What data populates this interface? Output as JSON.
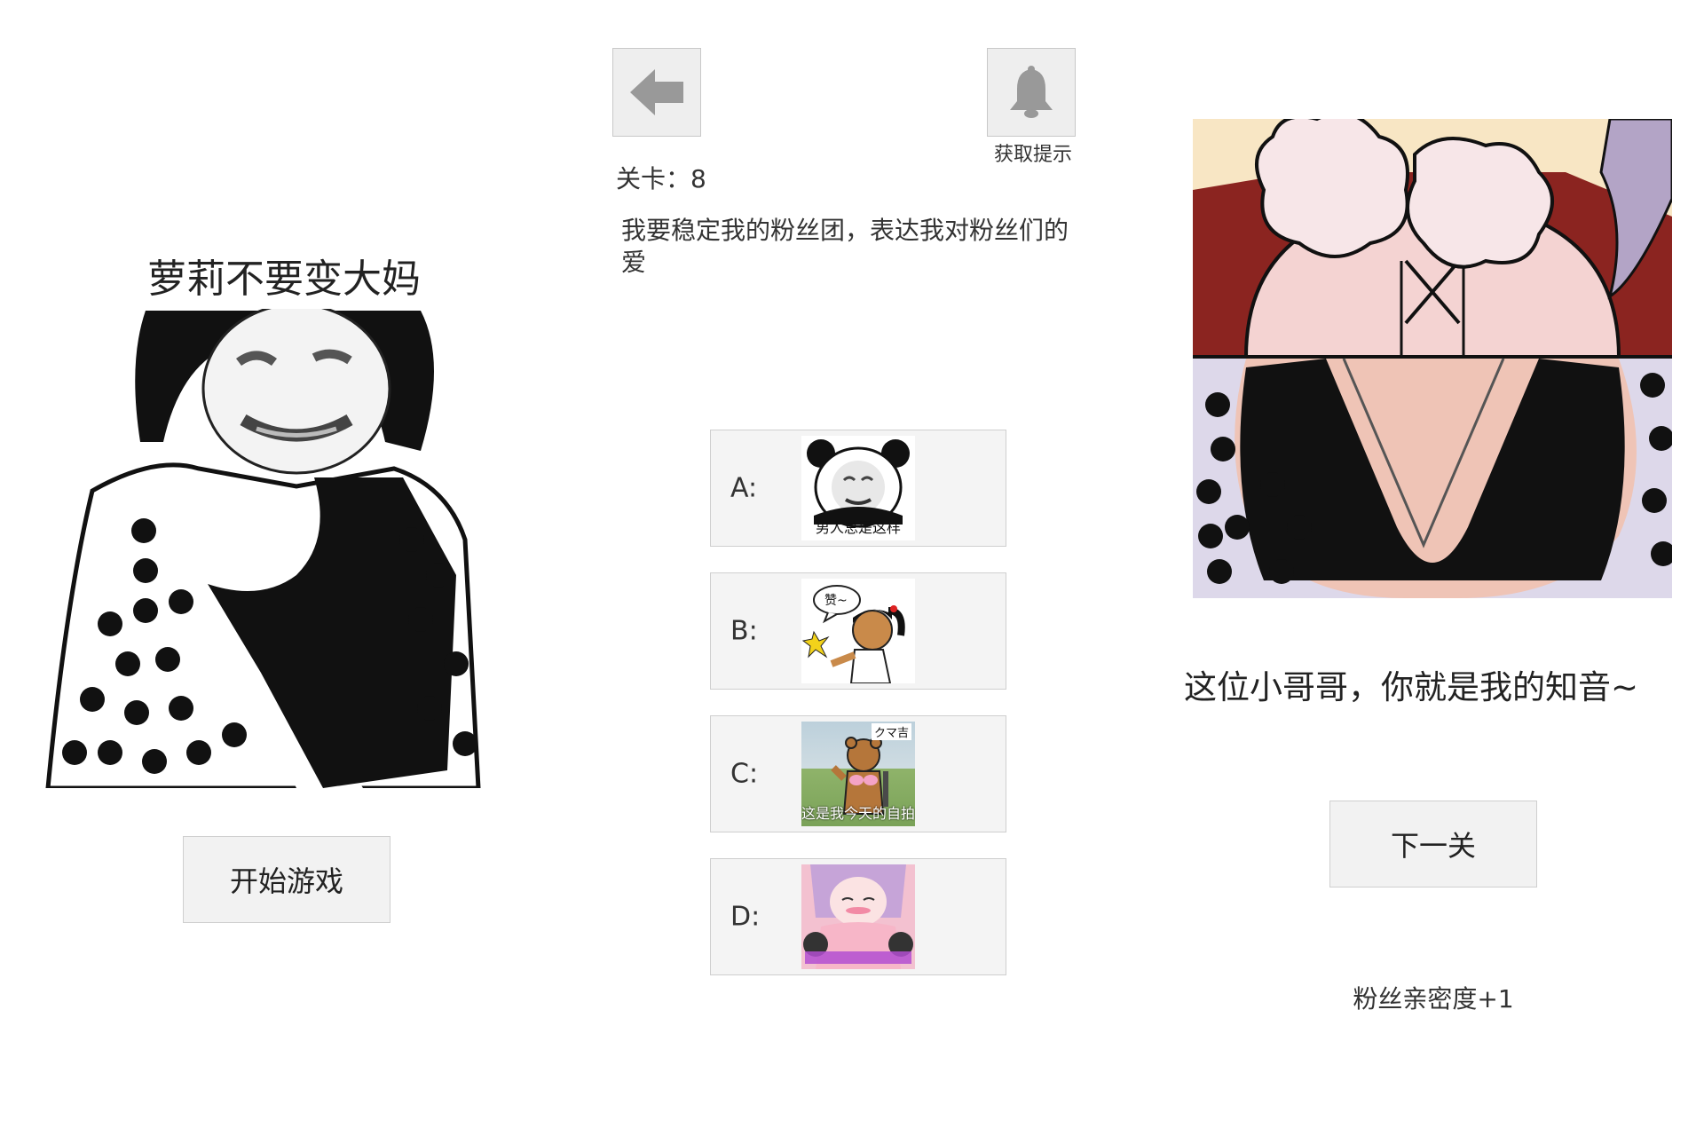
{
  "start_screen": {
    "title": "萝莉不要变大妈",
    "start_button": "开始游戏"
  },
  "question_screen": {
    "hint_label": "获取提示",
    "level_text": "关卡：8",
    "question": "我要稳定我的粉丝团，表达我对粉丝们的爱",
    "options": [
      {
        "letter": "A:",
        "caption": "男人总是这样",
        "icon": "panda-meme-image"
      },
      {
        "letter": "B:",
        "caption": "",
        "bubble": "赞~",
        "icon": "cartoon-girl-image"
      },
      {
        "letter": "C:",
        "caption": "这是我今天的自拍",
        "tag": "クマ吉",
        "icon": "bear-selfie-image"
      },
      {
        "letter": "D:",
        "caption": "",
        "icon": "anime-girl-image"
      }
    ]
  },
  "result_screen": {
    "message": "这位小哥哥，你就是我的知音~",
    "next_button": "下一关",
    "reward": "粉丝亲密度+1"
  }
}
